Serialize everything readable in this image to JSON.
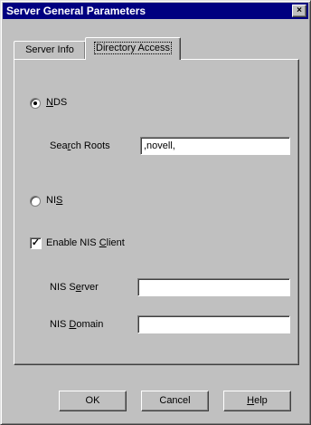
{
  "window": {
    "title": "Server General Parameters",
    "close_glyph": "×"
  },
  "tabs": [
    {
      "label": "Server Info"
    },
    {
      "label": "Directory Access",
      "selected": true
    }
  ],
  "nds": {
    "radio_selected": true,
    "label_first": "N",
    "label_rest": "DS",
    "search_roots_pre": "Sea",
    "search_roots_u": "r",
    "search_roots_post": "ch Roots",
    "search_roots_value": ",novell,"
  },
  "nis": {
    "radio_selected": false,
    "label_pre": "NI",
    "label_u": "S",
    "enable_checked": true,
    "check_glyph": "✓",
    "enable_pre": "Enable NIS ",
    "enable_u": "C",
    "enable_post": "lient",
    "server_pre": "NIS S",
    "server_u": "e",
    "server_post": "rver",
    "server_value": "",
    "domain_pre": "NIS ",
    "domain_u": "D",
    "domain_post": "omain",
    "domain_value": ""
  },
  "buttons": {
    "ok": "OK",
    "cancel": "Cancel",
    "help_u": "H",
    "help_rest": "elp"
  }
}
